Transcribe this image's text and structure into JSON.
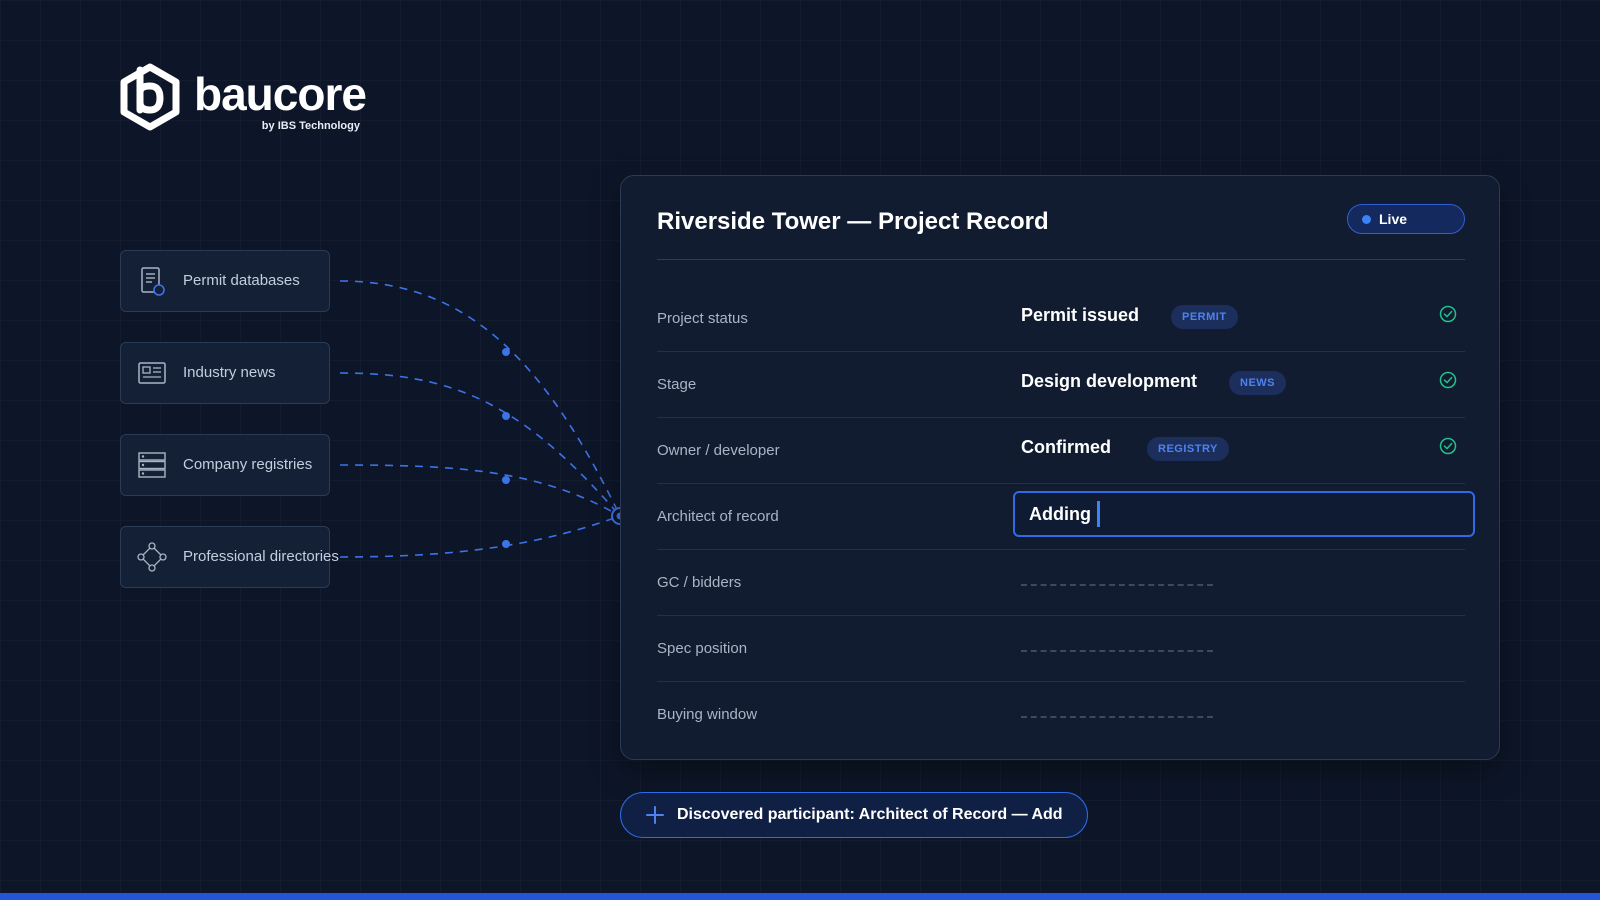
{
  "brand": {
    "name": "baucore",
    "tagline": "by IBS Technology"
  },
  "sources": [
    {
      "label": "Permit databases",
      "icon": "permit-document-icon"
    },
    {
      "label": "Industry news",
      "icon": "newspaper-icon"
    },
    {
      "label": "Company registries",
      "icon": "registry-stack-icon"
    },
    {
      "label": "Professional directories",
      "icon": "network-nodes-icon"
    }
  ],
  "record": {
    "title": "Riverside Tower — Project Record",
    "status_badge": "Live",
    "rows": [
      {
        "label": "Project status",
        "value": "Permit issued",
        "tag": "PERMIT",
        "verified": true
      },
      {
        "label": "Stage",
        "value": "Design development",
        "tag": "NEWS",
        "verified": true
      },
      {
        "label": "Owner / developer",
        "value": "Confirmed",
        "tag": "REGISTRY",
        "verified": true
      },
      {
        "label": "Architect of record",
        "value": "Adding",
        "state": "editing"
      },
      {
        "label": "GC / bidders",
        "state": "empty"
      },
      {
        "label": "Spec position",
        "state": "empty"
      },
      {
        "label": "Buying window",
        "state": "empty"
      }
    ]
  },
  "discovery": {
    "label": "Discovered participant: Architect of Record — Add"
  },
  "colors": {
    "background": "#0d1628",
    "card": "#111c31",
    "accent": "#2f6be6",
    "tag_text": "#4e83ee",
    "check_green": "#22c08a"
  }
}
